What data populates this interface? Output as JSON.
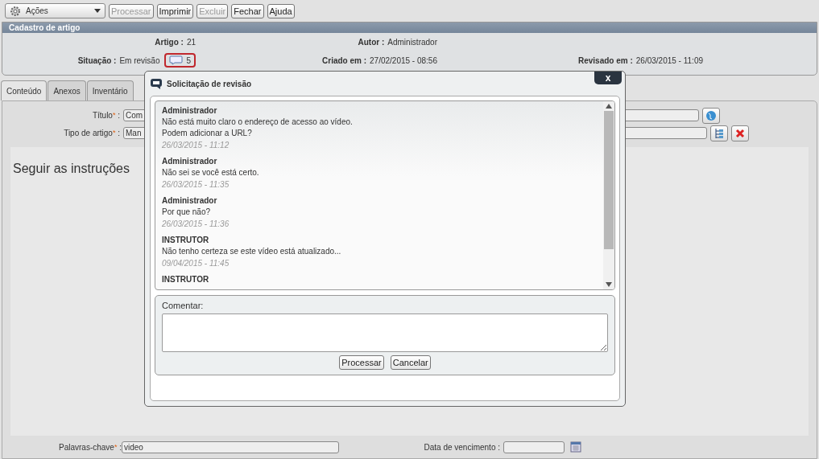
{
  "toolbar": {
    "actions_menu": "Ações",
    "buttons": [
      {
        "label": "Processar",
        "disabled": true
      },
      {
        "label": "Imprimir",
        "disabled": false
      },
      {
        "label": "Excluir",
        "disabled": true
      },
      {
        "label": "Fechar",
        "disabled": false
      },
      {
        "label": "Ajuda",
        "disabled": false
      }
    ]
  },
  "header": {
    "title": "Cadastro de artigo",
    "fields": [
      {
        "label": "Artigo :",
        "value": "21"
      },
      {
        "label": "Autor :",
        "value": "Administrador"
      },
      {
        "label": "Situação :",
        "value": "Em revisão",
        "comment_count": "5"
      },
      {
        "label": "Criado em :",
        "value": "27/02/2015 - 08:56"
      },
      {
        "label": "Revisado em :",
        "value": "26/03/2015 - 11:09"
      }
    ]
  },
  "tabs": [
    {
      "label": "Conteúdo",
      "selected": true
    },
    {
      "label": "Anexos",
      "selected": false
    },
    {
      "label": "Inventário",
      "selected": false
    }
  ],
  "form": {
    "title_label": "Título",
    "title_value": "Com",
    "type_label": "Tipo de artigo",
    "type_value": "Man",
    "required_mark": "*",
    "separator": ":",
    "body_text": "Seguir as instruções",
    "keywords_label": "Palavras-chave",
    "keywords_value": "video",
    "due_label": "Data de vencimento :"
  },
  "dialog": {
    "title": "Solicitação de revisão",
    "close": "x",
    "messages": [
      {
        "author": "Administrador",
        "text": [
          "Não está muito claro o endereço de acesso ao vídeo.",
          "Podem adicionar a URL?"
        ],
        "time": "26/03/2015 - 11:12"
      },
      {
        "author": "Administrador",
        "text": [
          "Não sei se você está certo."
        ],
        "time": "26/03/2015 - 11:35"
      },
      {
        "author": "Administrador",
        "text": [
          "Por que não?"
        ],
        "time": "26/03/2015 - 11:36"
      },
      {
        "author": "INSTRUTOR",
        "text": [
          "Não tenho certeza se este vídeo está atualizado..."
        ],
        "time": "09/04/2015 - 11:45"
      },
      {
        "author": "INSTRUTOR"
      }
    ],
    "comment_label": "Comentar:",
    "buttons": [
      "Processar",
      "Cancelar"
    ]
  }
}
